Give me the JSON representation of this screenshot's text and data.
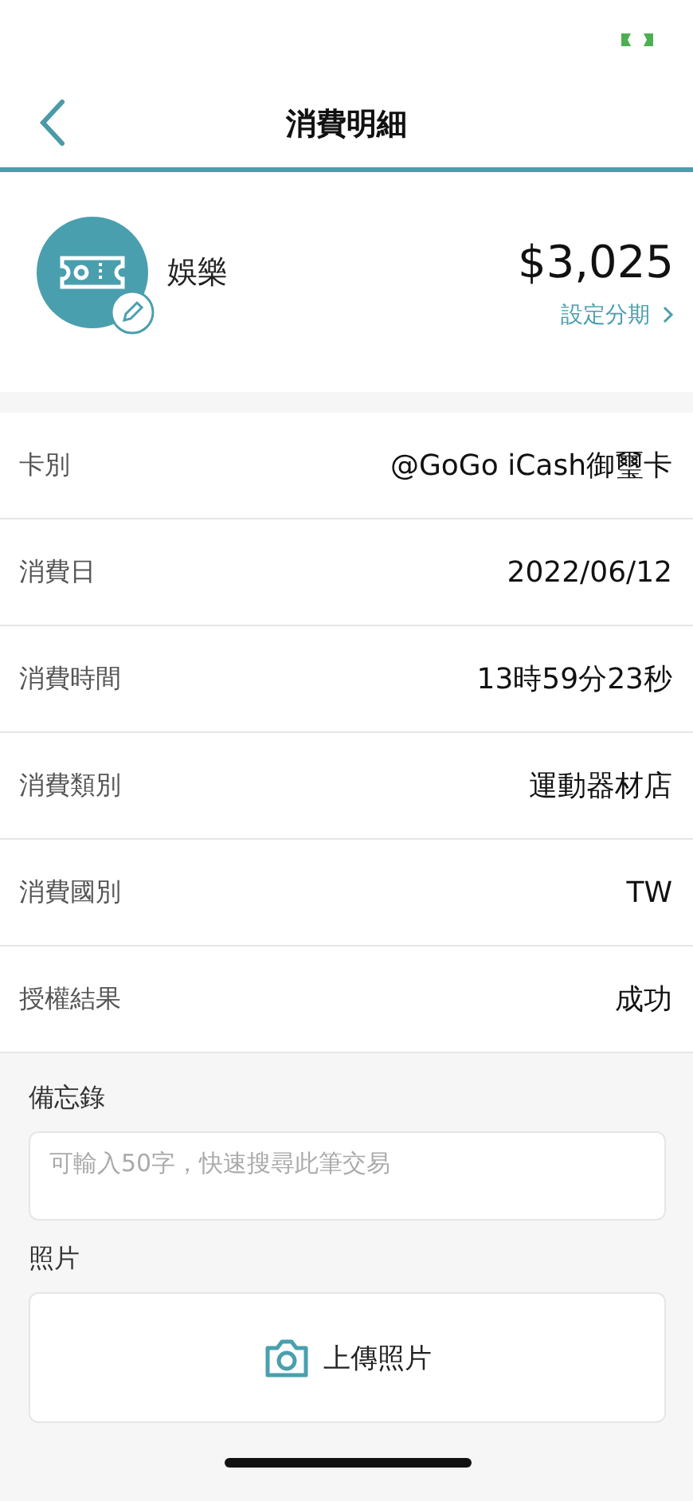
{
  "header": {
    "title": "消費明細"
  },
  "summary": {
    "category": "娛樂",
    "amount": "$3,025",
    "installment_link": "設定分期"
  },
  "details": [
    {
      "label": "卡別",
      "value": "@GoGo iCash御璽卡"
    },
    {
      "label": "消費日",
      "value": "2022/06/12"
    },
    {
      "label": "消費時間",
      "value": "13時59分23秒"
    },
    {
      "label": "消費類別",
      "value": "運動器材店"
    },
    {
      "label": "消費國別",
      "value": "TW"
    },
    {
      "label": "授權結果",
      "value": "成功"
    }
  ],
  "memo": {
    "label": "備忘錄",
    "placeholder": "可輸入50字，快速搜尋此筆交易"
  },
  "photo": {
    "label": "照片",
    "button": "上傳照片"
  }
}
